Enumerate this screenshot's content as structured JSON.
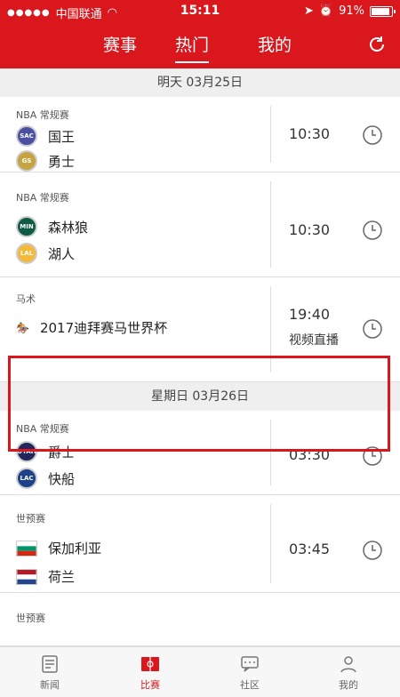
{
  "status": {
    "carrier": "中国联通",
    "time": "15:11",
    "battery": "91%"
  },
  "tabs": [
    {
      "label": "赛事"
    },
    {
      "label": "热门"
    },
    {
      "label": "我的"
    }
  ],
  "sections": [
    {
      "date": "明天  03月25日",
      "matches": [
        {
          "league": "NBA 常规赛",
          "teams": [
            {
              "name": "国王",
              "logo": "SAC"
            },
            {
              "name": "勇士",
              "logo": "GS"
            }
          ],
          "time": "10:30"
        },
        {
          "league": "NBA 常规赛",
          "teams": [
            {
              "name": "森林狼",
              "logo": "MIN"
            },
            {
              "name": "湖人",
              "logo": "LAL"
            }
          ],
          "time": "10:30"
        },
        {
          "league": "马术",
          "event": "2017迪拜赛马世界杯",
          "time": "19:40",
          "status": "视频直播"
        }
      ]
    },
    {
      "date": "星期日  03月26日",
      "matches": [
        {
          "league": "NBA 常规赛",
          "teams": [
            {
              "name": "爵士",
              "logo": "UTAH"
            },
            {
              "name": "快船",
              "logo": "LAC"
            }
          ],
          "time": "03:30"
        },
        {
          "league": "世预赛",
          "teams": [
            {
              "name": "保加利亚"
            },
            {
              "name": "荷兰"
            }
          ],
          "time": "03:45"
        },
        {
          "league": "世预赛"
        }
      ]
    }
  ],
  "bottom_nav": [
    {
      "label": "新闻"
    },
    {
      "label": "比赛"
    },
    {
      "label": "社区"
    },
    {
      "label": "我的"
    }
  ],
  "colors": {
    "accent": "#d9171d"
  }
}
